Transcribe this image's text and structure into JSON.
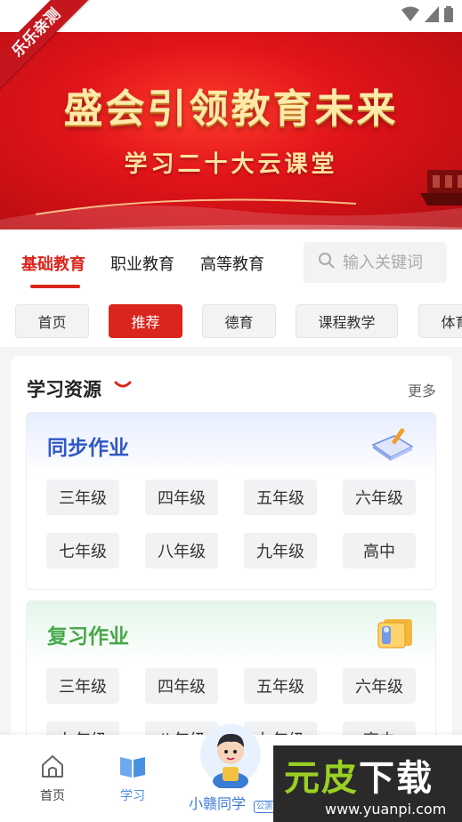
{
  "ribbon": {
    "label": "乐乐亲测"
  },
  "banner": {
    "title": "盛会引领教育未来",
    "subtitle": "学习二十大云课堂"
  },
  "categories": {
    "tabs": [
      {
        "label": "基础教育"
      },
      {
        "label": "职业教育"
      },
      {
        "label": "高等教育"
      }
    ],
    "active_index": 0
  },
  "search": {
    "placeholder": "输入关键词"
  },
  "chips": [
    {
      "label": "首页"
    },
    {
      "label": "推荐"
    },
    {
      "label": "德育"
    },
    {
      "label": "课程教学"
    },
    {
      "label": "体育"
    }
  ],
  "chips_active_index": 1,
  "resources": {
    "title": "学习资源",
    "more_label": "更多",
    "sections": [
      {
        "title": "同步作业",
        "icon": "notebook-icon",
        "grades": [
          "三年级",
          "四年级",
          "五年级",
          "六年级",
          "七年级",
          "八年级",
          "九年级",
          "高中"
        ]
      },
      {
        "title": "复习作业",
        "icon": "folder-icon",
        "grades": [
          "三年级",
          "四年级",
          "五年级",
          "六年级",
          "七年级",
          "八年级",
          "九年级",
          "高中"
        ]
      }
    ]
  },
  "bottom_nav": {
    "items": [
      {
        "label": "首页",
        "icon": "home-icon"
      },
      {
        "label": "学习",
        "icon": "book-icon"
      }
    ],
    "active_index": 1,
    "assistant": {
      "label": "小赣同学",
      "badge": "公测"
    }
  },
  "watermark": {
    "main_left": "元",
    "main_right": "皮",
    "main_tail": "下载",
    "url": "www.yuanpi.com"
  },
  "colors": {
    "accent": "#d9251d",
    "nav_active": "#4a90e2",
    "sync_title": "#2f57c6",
    "review_title": "#47a84a"
  }
}
